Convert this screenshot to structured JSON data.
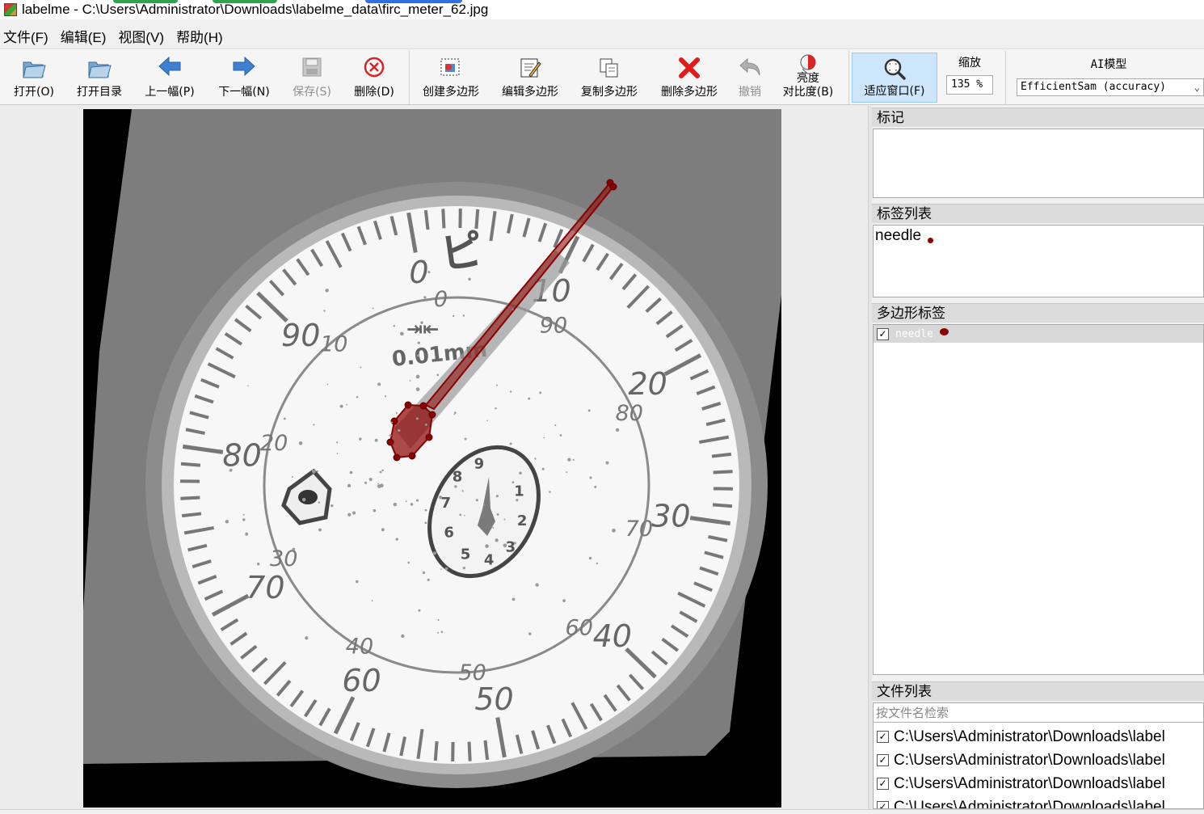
{
  "window": {
    "title": "labelme - C:\\Users\\Administrator\\Downloads\\labelme_data\\firc_meter_62.jpg"
  },
  "menu": [
    "文件(F)",
    "编辑(E)",
    "视图(V)",
    "帮助(H)"
  ],
  "toolbar": {
    "open": "打开(O)",
    "open_dir": "打开目录",
    "prev": "上一幅(P)",
    "next": "下一幅(N)",
    "save": "保存(S)",
    "delete": "删除(D)",
    "create_polygon": "创建多边形",
    "edit_polygon": "编辑多边形",
    "copy_polygon": "复制多边形",
    "delete_polygon": "删除多边形",
    "undo": "撤销",
    "brightness_line1": "亮度",
    "brightness_line2": "对比度(B)",
    "fit_window": "适应窗口(F)",
    "zoom_label": "缩放",
    "zoom_value": "135 %",
    "ai_label": "AI模型",
    "ai_value": "EfficientSam (accuracy)"
  },
  "gauge": {
    "outer_labels": [
      "0",
      "10",
      "20",
      "30",
      "40",
      "50",
      "60",
      "70",
      "80",
      "90"
    ],
    "inner_labels": [
      "0",
      "90",
      "80",
      "70",
      "60",
      "50",
      "40",
      "30",
      "20",
      "10"
    ],
    "unit": "0.01mm",
    "brand": "ピ",
    "sub_dial": [
      "1",
      "2",
      "3",
      "4",
      "5",
      "6",
      "7",
      "8",
      "9"
    ]
  },
  "annotation": {
    "label": "needle",
    "color": "#8b0000"
  },
  "docks": {
    "flags_title": "标记",
    "labels_title": "标签列表",
    "labels": [
      {
        "text": "needle",
        "color": "#8b0000"
      }
    ],
    "polygons_title": "多边形标签",
    "polygons": [
      {
        "text": "needle",
        "checked": true,
        "color": "#8b0000"
      }
    ],
    "files_title": "文件列表",
    "file_search_placeholder": "按文件名检索",
    "files": [
      "C:\\Users\\Administrator\\Downloads\\label",
      "C:\\Users\\Administrator\\Downloads\\label",
      "C:\\Users\\Administrator\\Downloads\\label",
      "C:\\Users\\Administrator\\Downloads\\label"
    ]
  }
}
